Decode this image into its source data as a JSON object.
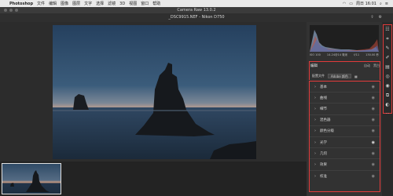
{
  "menubar": {
    "app": "Photoshop",
    "items": [
      "文件",
      "编辑",
      "图像",
      "图层",
      "文字",
      "选择",
      "滤镜",
      "3D",
      "视图",
      "窗口",
      "帮助"
    ],
    "time": "周日 16:01"
  },
  "window": {
    "title": "Camera Raw 13.0.2"
  },
  "file": {
    "name": "_DSC9915.NEF  -  Nikon D750"
  },
  "camera_info": [
    "ISO 100",
    "14-24@14 毫米",
    "f/11",
    "130.00 秒"
  ],
  "edit": {
    "title": "编辑",
    "auto_label": "自动",
    "bw_label": "黑白"
  },
  "profile": {
    "label": "配置文件",
    "value": "Adobe 颜色"
  },
  "sections": [
    "基本",
    "曲线",
    "细节",
    "混色器",
    "颜色分级",
    "光学",
    "几何",
    "效果",
    "校准"
  ],
  "accent_color": "#e23b3b"
}
